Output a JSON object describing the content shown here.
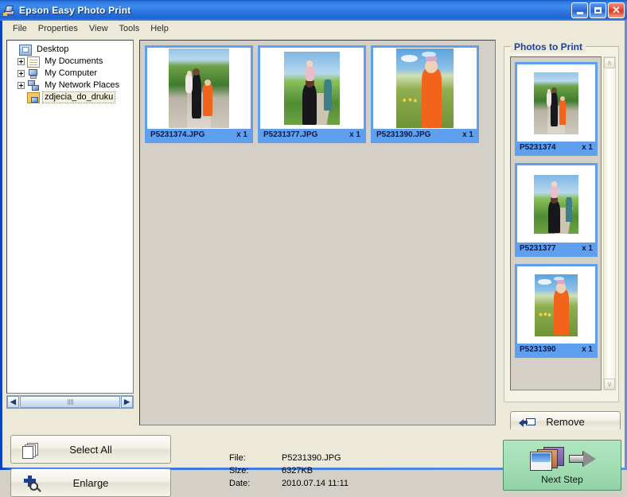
{
  "window": {
    "title": "Epson Easy Photo Print",
    "icon": "epson-app-icon",
    "buttons": {
      "minimize": "minimize-button",
      "maximize": "maximize-button",
      "close_glyph": "✕"
    }
  },
  "menubar": {
    "items": [
      {
        "label": "File"
      },
      {
        "label": "Properties"
      },
      {
        "label": "View"
      },
      {
        "label": "Tools"
      },
      {
        "label": "Help"
      }
    ]
  },
  "tree": {
    "nodes": [
      {
        "label": "Desktop",
        "icon": "desktop-icon",
        "expandable": false,
        "indent": 0,
        "selected": false
      },
      {
        "label": "My Documents",
        "icon": "documents-folder-icon",
        "expandable": true,
        "indent": 1,
        "selected": false
      },
      {
        "label": "My Computer",
        "icon": "computer-icon",
        "expandable": true,
        "indent": 1,
        "selected": false
      },
      {
        "label": "My Network Places",
        "icon": "network-places-icon",
        "expandable": true,
        "indent": 1,
        "selected": false
      },
      {
        "label": "zdjecia_do_druku",
        "icon": "open-folder-icon",
        "expandable": false,
        "indent": 1,
        "selected": true
      }
    ],
    "hscrollbar": {
      "left_glyph": "◀",
      "right_glyph": "▶"
    }
  },
  "thumbnails": {
    "items": [
      {
        "filename": "P5231374.JPG",
        "count": "x 1",
        "photo": "ph-a"
      },
      {
        "filename": "P5231377.JPG",
        "count": "x 1",
        "photo": "ph-b"
      },
      {
        "filename": "P5231390.JPG",
        "count": "x 1",
        "photo": "ph-c"
      }
    ]
  },
  "photos_to_print": {
    "legend": "Photos to Print",
    "items": [
      {
        "filename": "P5231374",
        "count": "x 1",
        "photo": "ph-a"
      },
      {
        "filename": "P5231377",
        "count": "x 1",
        "photo": "ph-b"
      },
      {
        "filename": "P5231390",
        "count": "x 1",
        "photo": "ph-c"
      }
    ],
    "scrollbar": {
      "up_glyph": "∧",
      "down_glyph": "∨"
    },
    "remove_button": {
      "label": "Remove",
      "icon": "left-arrow-remove-icon"
    }
  },
  "bottom": {
    "select_all_button": {
      "label": "Select All",
      "icon": "stacked-pages-icon"
    },
    "enlarge_button": {
      "label": "Enlarge",
      "icon": "magnifier-plus-icon"
    },
    "file_info": {
      "file_key": "File:",
      "file_value": "P5231390.JPG",
      "size_key": "Size:",
      "size_value": "6327KB",
      "date_key": "Date:",
      "date_value": "2010.07.14 11:11"
    },
    "next_step_button": {
      "label": "Next Step",
      "icon": "photo-stack-arrow-icon"
    }
  },
  "colors": {
    "titlebar_blue": "#2f78e0",
    "panel_beige": "#ece9d8",
    "thumb_border_blue": "#5fa0ee",
    "legend_blue": "#19409e",
    "next_step_green": "#a2ddb4"
  }
}
